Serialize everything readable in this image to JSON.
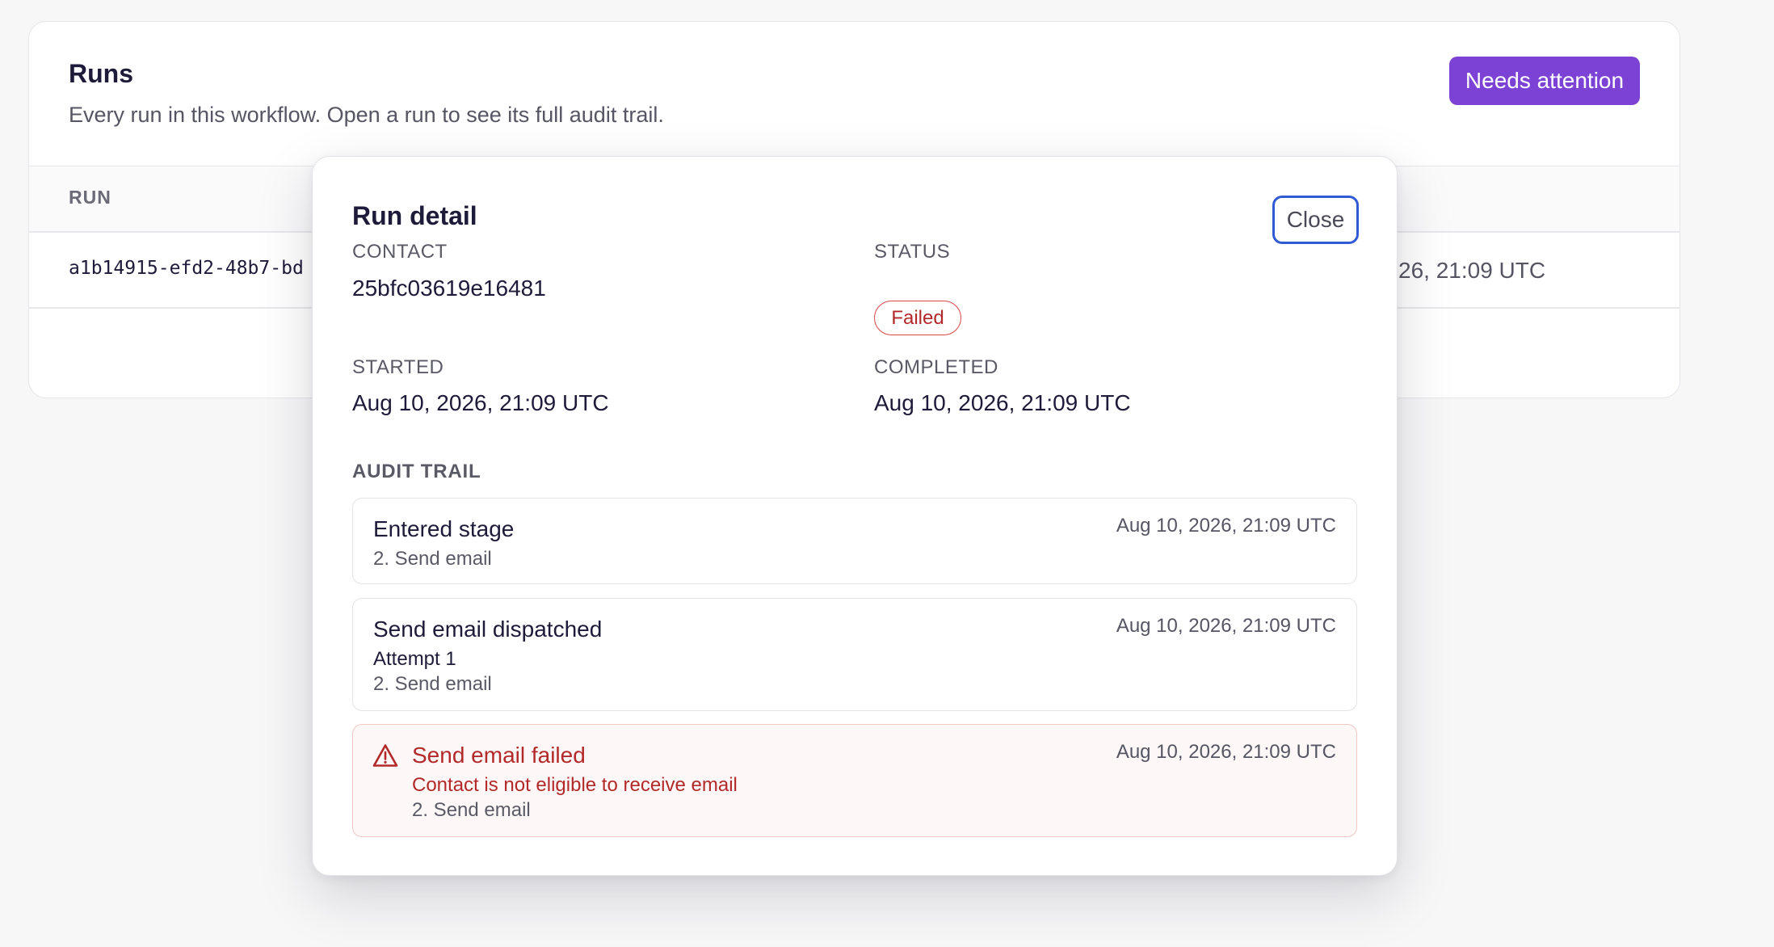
{
  "runs_card": {
    "title": "Runs",
    "subtitle": "Every run in this workflow. Open a run to see its full audit trail.",
    "attention_button": "Needs attention",
    "columns": {
      "run": "RUN"
    },
    "rows": [
      {
        "run_id": "a1b14915-efd2-48b7-bd",
        "date_fragment": "26, 21:09 UTC"
      }
    ]
  },
  "modal": {
    "title": "Run detail",
    "close_label": "Close",
    "contact": {
      "label": "CONTACT",
      "value": "25bfc03619e16481"
    },
    "status": {
      "label": "STATUS",
      "value": "Failed"
    },
    "started": {
      "label": "STARTED",
      "value": "Aug 10, 2026, 21:09 UTC"
    },
    "completed": {
      "label": "COMPLETED",
      "value": "Aug 10, 2026, 21:09 UTC"
    },
    "audit_heading": "AUDIT TRAIL",
    "events": [
      {
        "title": "Entered stage",
        "time": "Aug 10, 2026, 21:09 UTC",
        "stage": "2. Send email"
      },
      {
        "title": "Send email dispatched",
        "time": "Aug 10, 2026, 21:09 UTC",
        "detail": "Attempt 1",
        "stage": "2. Send email"
      },
      {
        "title": "Send email failed",
        "time": "Aug 10, 2026, 21:09 UTC",
        "detail": "Contact is not eligible to receive email",
        "stage": "2. Send email",
        "icon": "warning-icon"
      }
    ]
  },
  "colors": {
    "accent_purple": "#7c42d6",
    "focus_blue": "#2f5ad3",
    "error_red": "#b32828",
    "error_bg": "#fdf8f7"
  }
}
